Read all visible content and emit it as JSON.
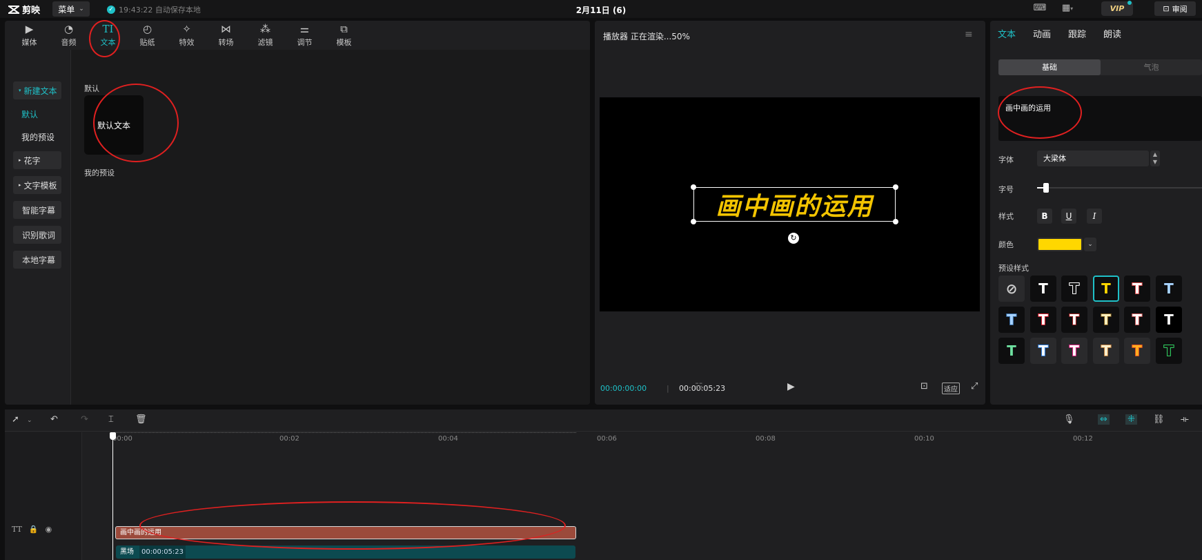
{
  "app": {
    "name": "剪映",
    "menu_label": "菜单",
    "autosave": "19:43:22 自动保存本地",
    "project_title": "2月11日 (6)",
    "vip_label": "VIP",
    "review_label": "审阅"
  },
  "media_tabs": [
    {
      "label": "媒体",
      "icon": "media-icon"
    },
    {
      "label": "音频",
      "icon": "audio-icon"
    },
    {
      "label": "文本",
      "icon": "text-icon",
      "active": true
    },
    {
      "label": "贴纸",
      "icon": "sticker-icon"
    },
    {
      "label": "特效",
      "icon": "effects-icon"
    },
    {
      "label": "转场",
      "icon": "transition-icon"
    },
    {
      "label": "滤镜",
      "icon": "filter-icon"
    },
    {
      "label": "调节",
      "icon": "adjust-icon"
    },
    {
      "label": "模板",
      "icon": "template-icon"
    }
  ],
  "text_nav": {
    "new_text": "新建文本",
    "default": "默认",
    "my_presets": "我的预设",
    "fancy": "花字",
    "text_template": "文字模板",
    "smart_captions": "智能字幕",
    "lyrics": "识别歌词",
    "local_captions": "本地字幕"
  },
  "text_content": {
    "section_default": "默认",
    "card_label": "默认文本",
    "section_presets": "我的预设"
  },
  "player": {
    "title": "播放器 正在渲染...50%",
    "caption": "画中画的运用",
    "time_current": "00:00:00:00",
    "time_total": "00:00:05:23",
    "fit_label": "适应"
  },
  "inspector": {
    "tabs": [
      "文本",
      "动画",
      "跟踪",
      "朗读"
    ],
    "seg_basic": "基础",
    "seg_bubble": "气泡",
    "text_value": "画中画的运用",
    "font_label": "字体",
    "font_value": "大梁体",
    "size_label": "字号",
    "size_level": 0.05,
    "style_label": "样式",
    "color_label": "颜色",
    "color_value": "#ffd700",
    "presets_label": "预设样式",
    "preset_styles": [
      {
        "glyph": "⃠",
        "fill": "#cfcfcf",
        "bg": "#2a2a2c"
      },
      {
        "glyph": "T",
        "fill": "#ffffff",
        "bg": "#0e0e0f"
      },
      {
        "glyph": "T",
        "fill": "#111111",
        "bg": "#0e0e0f",
        "stroke": "#ffffff"
      },
      {
        "glyph": "T",
        "fill": "#ffd700",
        "bg": "#0e0e0f",
        "selected": true
      },
      {
        "glyph": "T",
        "fill": "#ffffff",
        "bg": "#0e0e0f",
        "stroke": "#e05050"
      },
      {
        "glyph": "T",
        "fill": "#a8d4ff",
        "bg": "#0e0e0f"
      },
      {
        "glyph": "T",
        "fill": "#a8d4ff",
        "bg": "#0e0e0f",
        "stroke": "#3a6ea5"
      },
      {
        "glyph": "T",
        "fill": "#ffffff",
        "bg": "#0e0e0f",
        "stroke": "#e02030"
      },
      {
        "glyph": "T",
        "fill": "#ffffff",
        "bg": "#0e0e0f",
        "stroke": "#a02020"
      },
      {
        "glyph": "T",
        "fill": "#fff3c0",
        "bg": "#0e0e0f",
        "stroke": "#806020"
      },
      {
        "glyph": "T",
        "fill": "#ffffff",
        "bg": "#0e0e0f",
        "stroke": "#d06060"
      },
      {
        "glyph": "T",
        "fill": "#ffffff",
        "bg": "#000000"
      },
      {
        "glyph": "T",
        "fill": "#6fe0a0",
        "bg": "#0e0e0f"
      },
      {
        "glyph": "T",
        "fill": "#ffffff",
        "bg": "#2a2a2c",
        "stroke": "#3080e0"
      },
      {
        "glyph": "T",
        "fill": "#ffffff",
        "bg": "#2a2a2c",
        "stroke": "#e02080"
      },
      {
        "glyph": "T",
        "fill": "#fff3d0",
        "bg": "#2a2a2c",
        "stroke": "#c08040"
      },
      {
        "glyph": "T",
        "fill": "#ffb020",
        "bg": "#2a2a2c",
        "stroke": "#e05020"
      },
      {
        "glyph": "T",
        "fill": "#111111",
        "bg": "#0e0e0f",
        "stroke": "#30d060"
      }
    ]
  },
  "timeline": {
    "ruler": [
      "00:00",
      "00:02",
      "00:04",
      "00:06",
      "00:08",
      "00:10",
      "00:12"
    ],
    "text_clip": "画中画的运用",
    "black_clip": "黑场",
    "black_clip_duration": "00:00:05:23",
    "track_label": "TT"
  },
  "colors": {
    "accent": "#1fc1c8",
    "annotation": "#e02020",
    "text_clip": "#9b4a3b",
    "video_clip": "#0c4a50"
  }
}
